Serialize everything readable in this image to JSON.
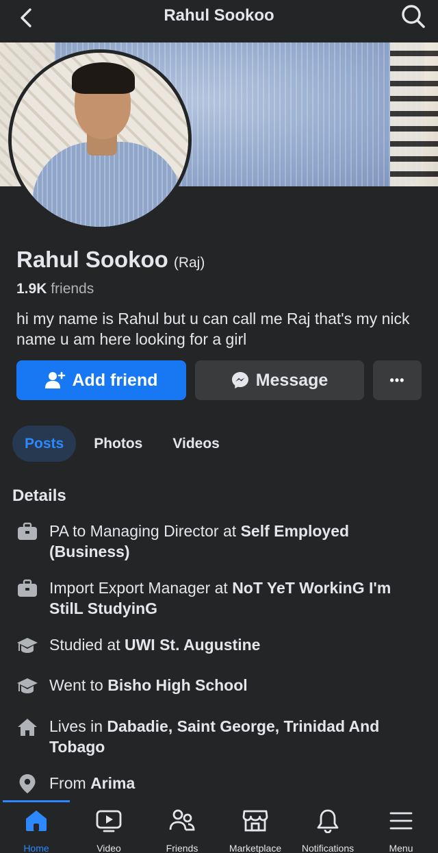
{
  "header": {
    "title": "Rahul Sookoo",
    "back_icon": "chevron-left-icon",
    "search_icon": "search-icon"
  },
  "profile": {
    "name": "Rahul Sookoo",
    "alternate_name": "(Raj)",
    "friends_count": "1.9K",
    "friends_label": "friends",
    "bio": "hi my name is Rahul but u can call me Raj that's my nick name u am here looking for a girl"
  },
  "actions": {
    "add_friend_label": "Add friend",
    "message_label": "Message",
    "more_label": "•••"
  },
  "tabs": [
    {
      "label": "Posts",
      "active": true
    },
    {
      "label": "Photos",
      "active": false
    },
    {
      "label": "Videos",
      "active": false
    }
  ],
  "details": {
    "title": "Details",
    "items": [
      {
        "icon": "briefcase-icon",
        "prefix": "PA to Managing Director at ",
        "value": "Self Employed (Business)"
      },
      {
        "icon": "briefcase-icon",
        "prefix": "Import Export Manager at ",
        "value": "NoT YeT WorkinG I'm StilL StudyinG"
      },
      {
        "icon": "graduation-cap-icon",
        "prefix": "Studied at ",
        "value": "UWI St. Augustine"
      },
      {
        "icon": "graduation-cap-icon",
        "prefix": "Went to ",
        "value": "Bisho High School"
      },
      {
        "icon": "home-icon",
        "prefix": "Lives in ",
        "value": "Dabadie, Saint George, Trinidad And Tobago"
      },
      {
        "icon": "location-pin-icon",
        "prefix": "From ",
        "value": "Arima"
      }
    ]
  },
  "bottom_nav": [
    {
      "label": "Home",
      "icon": "home-icon",
      "active": true
    },
    {
      "label": "Video",
      "icon": "video-icon",
      "active": false
    },
    {
      "label": "Friends",
      "icon": "friends-icon",
      "active": false
    },
    {
      "label": "Marketplace",
      "icon": "marketplace-icon",
      "active": false
    },
    {
      "label": "Notifications",
      "icon": "bell-icon",
      "active": false
    },
    {
      "label": "Menu",
      "icon": "menu-icon",
      "active": false
    }
  ],
  "colors": {
    "background": "#242526",
    "accent": "#1877f2",
    "active_tab_bg": "#263951",
    "active_text": "#2d88ff",
    "secondary_button": "#3a3b3c"
  }
}
